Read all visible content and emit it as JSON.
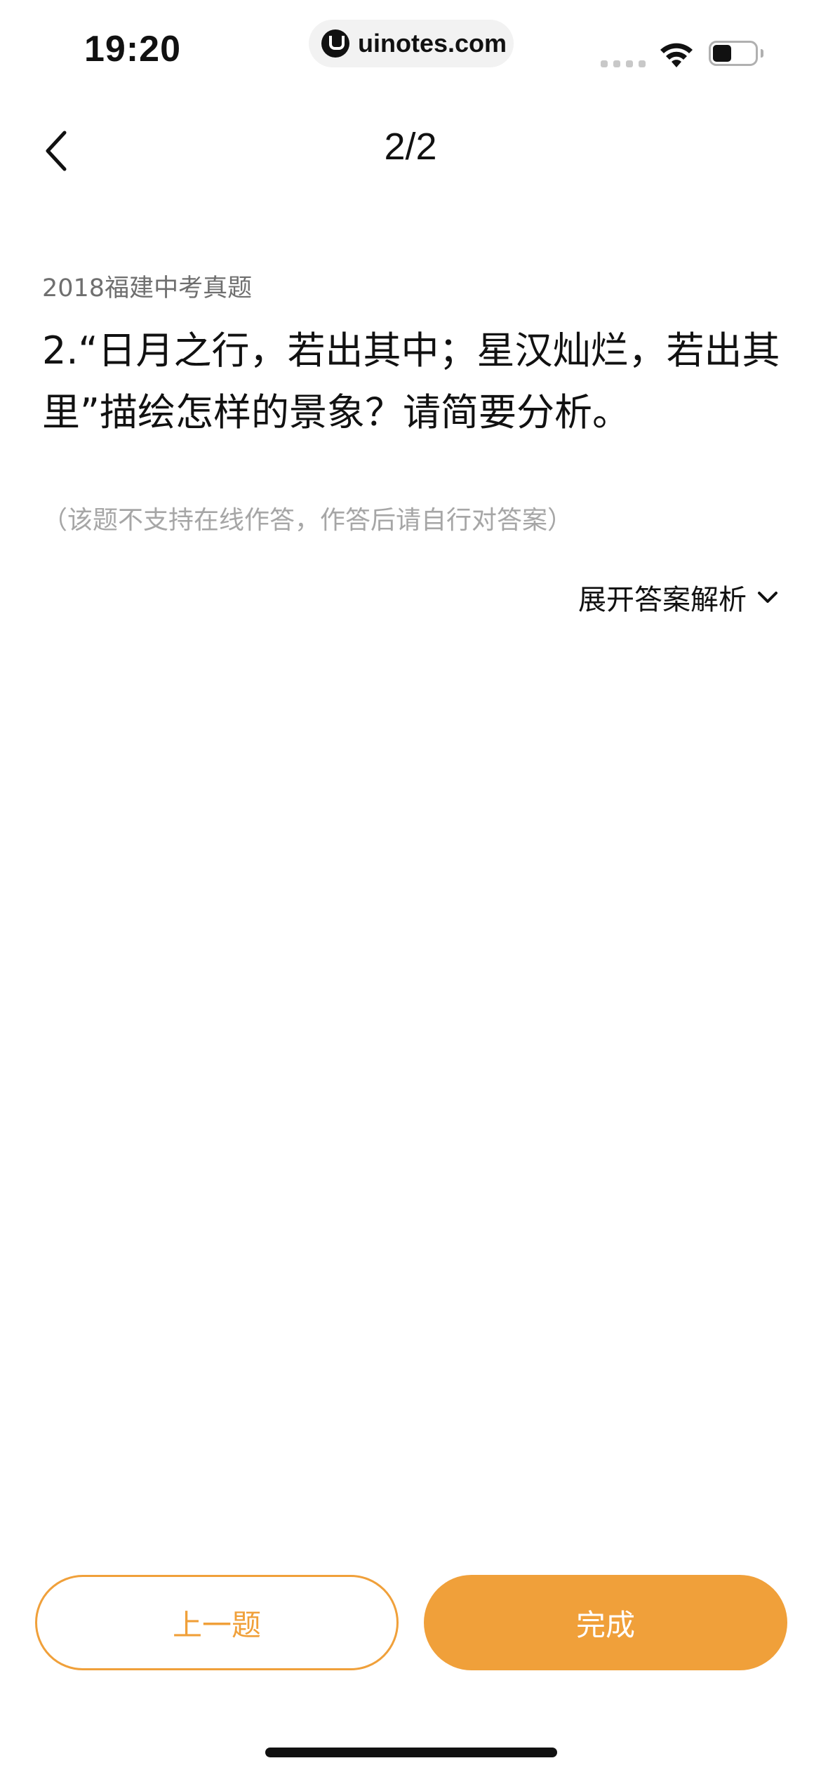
{
  "status_bar": {
    "time": "19:20",
    "url": "uinotes.com"
  },
  "nav": {
    "title": "2/2"
  },
  "question": {
    "source": "2018福建中考真题",
    "text": "2.“日月之行，若出其中；星汉灿烂，若出其里”描绘怎样的景象？请简要分析。",
    "hint": "（该题不支持在线作答，作答后请自行对答案）"
  },
  "answer": {
    "expand_label": "展开答案解析"
  },
  "buttons": {
    "prev_label": "上一题",
    "done_label": "完成"
  },
  "colors": {
    "accent": "#f0a03a",
    "hint_text": "#a6a6a6",
    "source_text": "#6f6f6f"
  }
}
